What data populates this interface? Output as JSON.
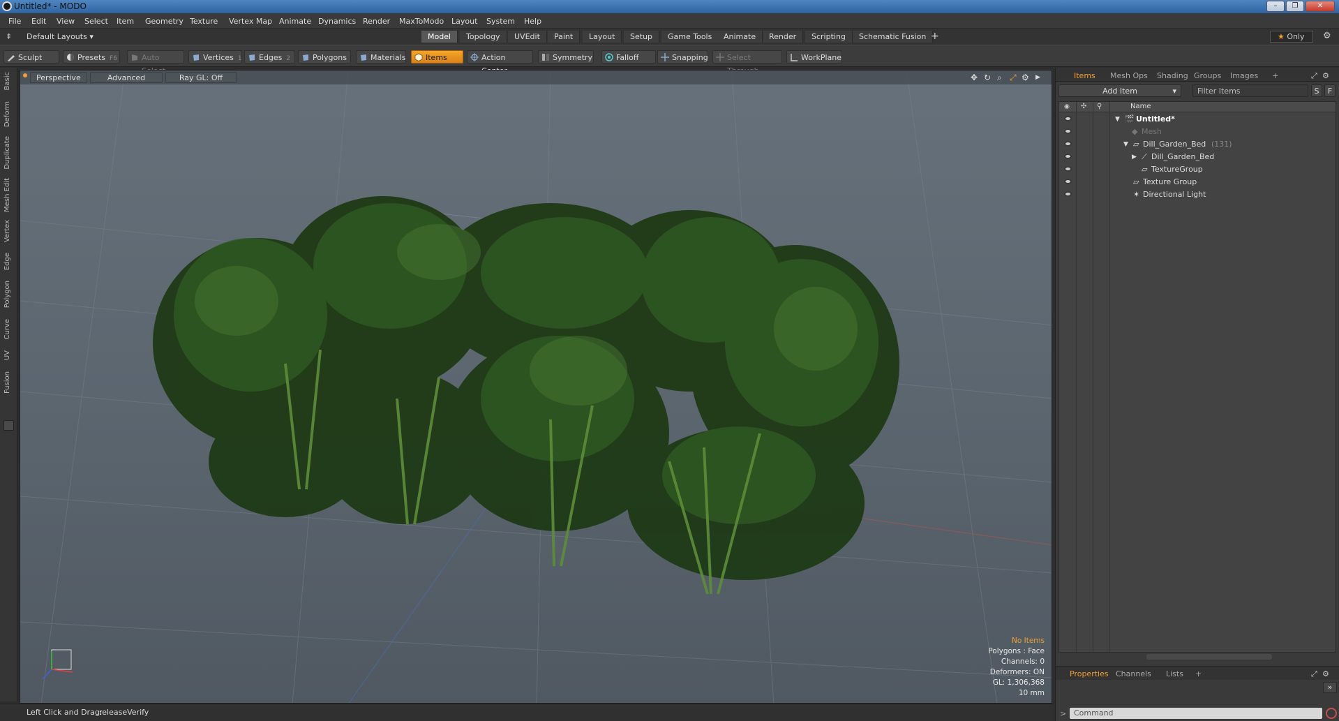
{
  "window": {
    "title": "Untitled* - MODO"
  },
  "menu": [
    "File",
    "Edit",
    "View",
    "Select",
    "Item",
    "Geometry",
    "Texture",
    "Vertex Map",
    "Animate",
    "Dynamics",
    "Render",
    "MaxToModo",
    "Layout",
    "System",
    "Help"
  ],
  "layoutbar": {
    "layouts_label": "Default Layouts",
    "tabs": [
      "Model",
      "Topology",
      "UVEdit",
      "Paint",
      "Layout",
      "Setup",
      "Game Tools",
      "Animate",
      "Render",
      "Scripting",
      "Schematic Fusion"
    ],
    "active_tab": "Model",
    "add_tab": "+",
    "only_label": "Only"
  },
  "toolbar": {
    "sculpt": "Sculpt",
    "presets": "Presets",
    "presets_key": "F6",
    "auto_select": "Auto Select",
    "vertices": "Vertices",
    "vertices_key": "1",
    "edges": "Edges",
    "edges_key": "2",
    "polygons": "Polygons",
    "materials": "Materials",
    "items": "Items",
    "action_center": "Action Center",
    "symmetry": "Symmetry",
    "falloff": "Falloff",
    "snapping": "Snapping",
    "select_through": "Select Through",
    "workplane": "WorkPlane"
  },
  "left_tabs": [
    "Basic",
    "Deform",
    "Duplicate",
    "Mesh Edit",
    "Vertex",
    "Edge",
    "Polygon",
    "Curve",
    "UV",
    "Fusion"
  ],
  "viewport": {
    "view_mode": "Perspective",
    "advanced": "Advanced",
    "raygl": "Ray GL: Off",
    "stats": {
      "items": "No Items",
      "polygons": "Polygons : Face",
      "channels": "Channels: 0",
      "deformers": "Deformers: ON",
      "gl": "GL: 1,306,368",
      "scale": "10 mm"
    }
  },
  "panel": {
    "tabs": [
      "Items",
      "Mesh Ops",
      "Shading",
      "Groups",
      "Images"
    ],
    "active_tab": "Items",
    "add_item": "Add Item",
    "filter_placeholder": "Filter Items",
    "s_btn": "S",
    "f_btn": "F",
    "name_header": "Name",
    "tree": [
      {
        "label": "Untitled*",
        "bold": true
      },
      {
        "label": "Mesh",
        "dim": true
      },
      {
        "label": "Dill_Garden_Bed",
        "count": "(131)"
      },
      {
        "label": "Dill_Garden_Bed"
      },
      {
        "label": "TextureGroup"
      },
      {
        "label": "Texture Group"
      },
      {
        "label": "Directional Light"
      }
    ],
    "bottom_tabs": [
      "Properties",
      "Channels",
      "Lists"
    ],
    "bottom_active": "Properties",
    "command_placeholder": "Command"
  },
  "status": {
    "hint": "Left Click and Drag:",
    "command": "releaseVerify"
  },
  "colors": {
    "accent": "#f0a030",
    "titlebar": "#2f63a3",
    "viewport_bg": "#5f6972",
    "plant": "#2f5a22"
  }
}
